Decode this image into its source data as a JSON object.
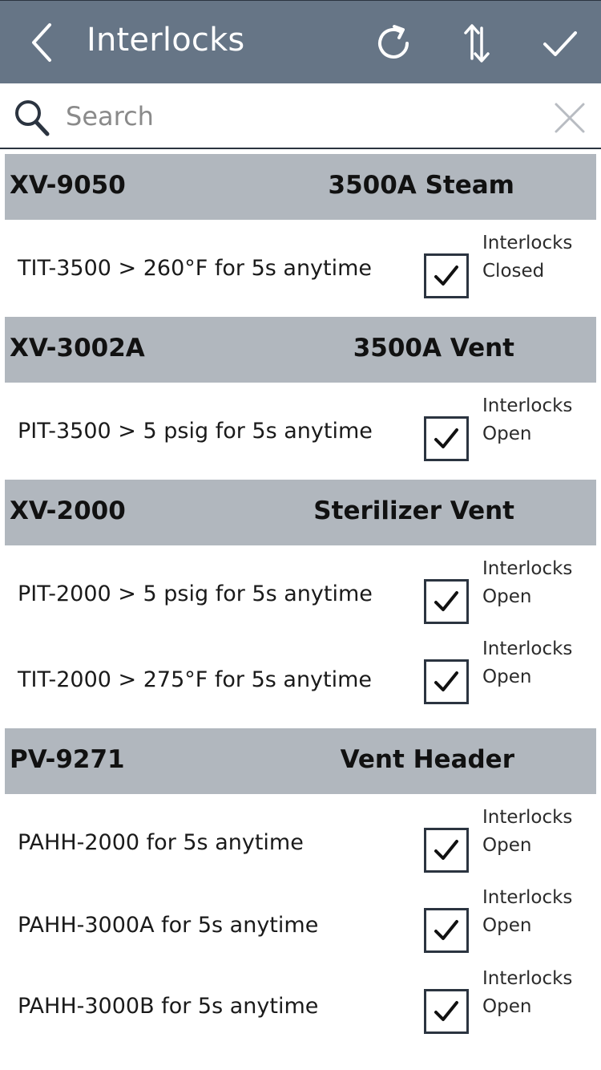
{
  "header": {
    "title": "Interlocks",
    "back_icon": "chevron-left-icon",
    "refresh_icon": "refresh-icon",
    "sort_icon": "sort-arrows-icon",
    "confirm_icon": "checkmark-icon"
  },
  "search": {
    "placeholder": "Search",
    "value": ""
  },
  "groups": [
    {
      "tag": "XV-9050",
      "description": "3500A Steam",
      "items": [
        {
          "condition": "TIT-3500 > 260°F for 5s anytime",
          "checked": true,
          "status_line1": "Interlocks",
          "status_line2": "Closed"
        }
      ]
    },
    {
      "tag": "XV-3002A",
      "description": "3500A Vent",
      "items": [
        {
          "condition": "PIT-3500 > 5 psig for 5s anytime",
          "checked": true,
          "status_line1": "Interlocks",
          "status_line2": "Open"
        }
      ]
    },
    {
      "tag": "XV-2000",
      "description": "Sterilizer Vent",
      "items": [
        {
          "condition": "PIT-2000 > 5 psig for 5s anytime",
          "checked": true,
          "status_line1": "Interlocks",
          "status_line2": "Open"
        },
        {
          "condition": "TIT-2000 > 275°F for 5s anytime",
          "checked": true,
          "status_line1": "Interlocks",
          "status_line2": "Open"
        }
      ]
    },
    {
      "tag": "PV-9271",
      "description": "Vent Header",
      "items": [
        {
          "condition": "PAHH-2000 for 5s anytime",
          "checked": true,
          "status_line1": "Interlocks",
          "status_line2": "Open"
        },
        {
          "condition": "PAHH-3000A for 5s anytime",
          "checked": true,
          "status_line1": "Interlocks",
          "status_line2": "Open"
        },
        {
          "condition": "PAHH-3000B for 5s anytime",
          "checked": true,
          "status_line1": "Interlocks",
          "status_line2": "Open"
        }
      ]
    }
  ],
  "colors": {
    "header_bg": "#667586",
    "group_bg": "#b1b7be",
    "border_dark": "#2b3440"
  }
}
